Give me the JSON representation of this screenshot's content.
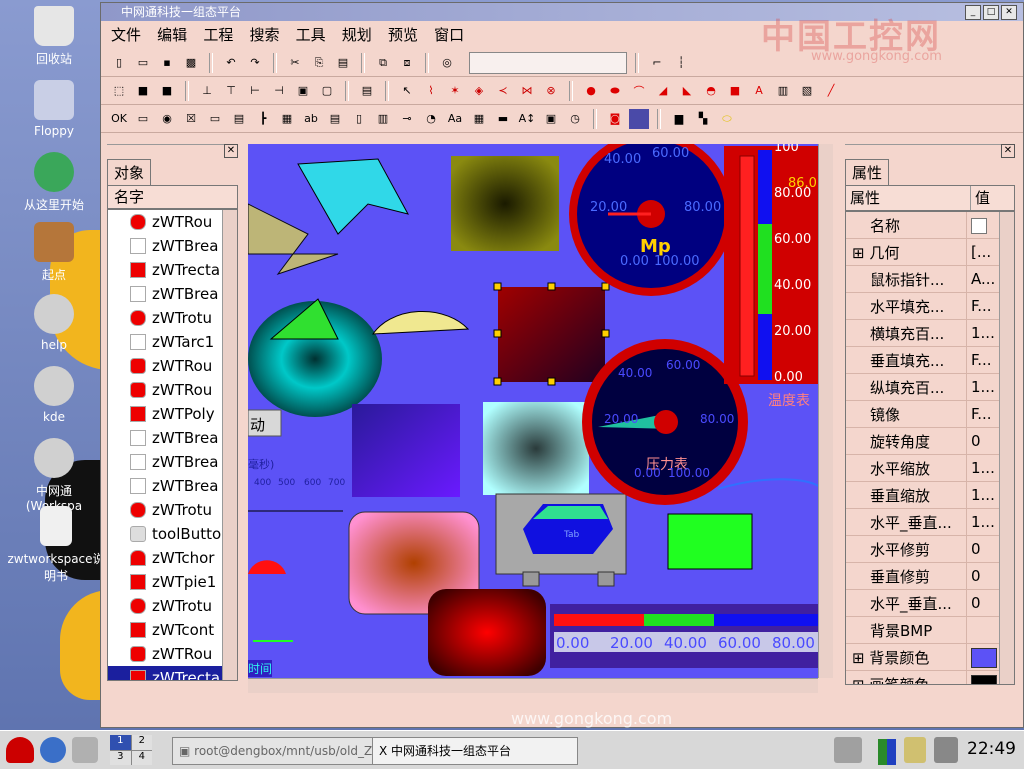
{
  "desktop": {
    "icons": [
      {
        "label": "回收站",
        "icon": "trash-icon"
      },
      {
        "label": "Floppy",
        "icon": "floppy-icon"
      },
      {
        "label": "从这里开始",
        "icon": "start-here-icon"
      },
      {
        "label": "起点",
        "icon": "home-icon"
      },
      {
        "label": "help",
        "icon": "gear-icon"
      },
      {
        "label": "kde",
        "icon": "gear-icon"
      },
      {
        "label": "中网通(Workspa",
        "icon": "gear-icon"
      },
      {
        "label": "zwtworkspace说明书",
        "icon": "document-icon"
      }
    ]
  },
  "window": {
    "title": "中网通科技一组态平台",
    "watermark_top": "中国工控网",
    "watermark_url": "www.gongkong.com",
    "watermark_bottom": "www.gongkong.com"
  },
  "menu": [
    "文件",
    "编辑",
    "工程",
    "搜索",
    "工具",
    "规划",
    "预览",
    "窗口"
  ],
  "left_panel": {
    "tab": "对象",
    "header": "名字",
    "items": [
      "zWTRou",
      "zWTBrea",
      "zWTrecta",
      "zWTBrea",
      "zWTrotu",
      "zWTarc1",
      "zWTRou",
      "zWTRou",
      "zWTPoly",
      "zWTBrea",
      "zWTBrea",
      "zWTBrea",
      "zWTrotu",
      "toolButto",
      "zWTchor",
      "zWTpie1",
      "zWTrotu",
      "zWTcont",
      "zWTRou",
      "zWTrecta"
    ]
  },
  "canvas": {
    "gauge1_label": "Mp",
    "gauge1_ticks": [
      "40.00",
      "60.00",
      "20.00",
      "80.00",
      "0.00",
      "100.00"
    ],
    "thermo_ticks": [
      "100",
      "80.00",
      "60.00",
      "40.00",
      "20.00",
      "0.00"
    ],
    "thermo_value": "86.0",
    "thermo_label": "温度表",
    "gauge2_label": "压力表",
    "gauge2_ticks": [
      "40.00",
      "60.00",
      "20.00",
      "80.00",
      "0.00",
      "100.00"
    ],
    "hbar_ticks": [
      "0.00",
      "20.00",
      "40.00",
      "60.00",
      "80.00"
    ],
    "button_label": "动",
    "axis_label": "毫秒)",
    "axis_ticks": [
      "400",
      "500",
      "600",
      "700"
    ],
    "time_label": "时间",
    "tank_label": "Tab"
  },
  "right_panel": {
    "tab": "属性",
    "col_name": "属性",
    "col_value": "值",
    "rows": [
      {
        "k": "名称",
        "v": ""
      },
      {
        "k": "几何",
        "v": "[..."
      },
      {
        "k": "鼠标指针...",
        "v": "A..."
      },
      {
        "k": "水平填充...",
        "v": "F..."
      },
      {
        "k": "横填充百...",
        "v": "1..."
      },
      {
        "k": "垂直填充...",
        "v": "F..."
      },
      {
        "k": "纵填充百...",
        "v": "1..."
      },
      {
        "k": "镜像",
        "v": "F..."
      },
      {
        "k": "旋转角度",
        "v": "0"
      },
      {
        "k": "水平缩放",
        "v": "1..."
      },
      {
        "k": "垂直缩放",
        "v": "1..."
      },
      {
        "k": "水平_垂直...",
        "v": "1..."
      },
      {
        "k": "水平修剪",
        "v": "0"
      },
      {
        "k": "垂直修剪",
        "v": "0"
      },
      {
        "k": "水平_垂直...",
        "v": "0"
      },
      {
        "k": "背景BMP",
        "v": ""
      },
      {
        "k": "背景颜色",
        "v": ""
      },
      {
        "k": "画笔颜色",
        "v": ""
      }
    ],
    "bg_color": "#5c52f6",
    "pen_color": "#000000"
  },
  "taskbar": {
    "pager": [
      "1",
      "2",
      "3",
      "4"
    ],
    "task1": "root@dengbox/mnt/usb/old_ZWTW",
    "task2": "中网通科技一组态平台",
    "clock": "22:49"
  }
}
